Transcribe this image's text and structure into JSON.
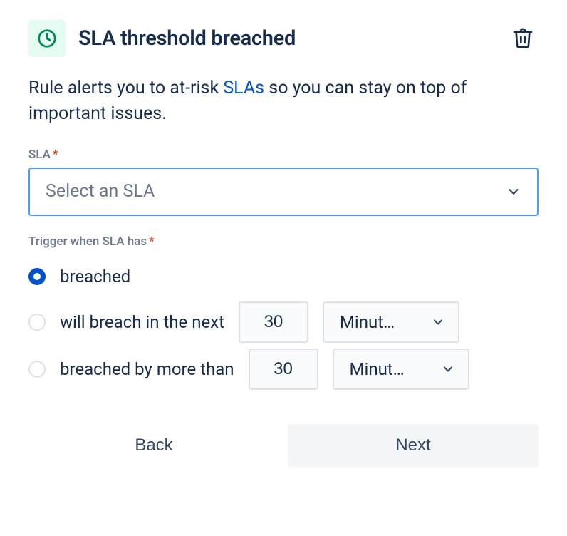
{
  "header": {
    "title": "SLA threshold breached",
    "icon_name": "clock-icon",
    "badge_bg": "#e3fcef",
    "icon_color": "#00875a"
  },
  "description": {
    "prefix": "Rule alerts you to at-risk ",
    "link_text": "SLAs",
    "suffix": " so you can stay on top of important issues."
  },
  "fields": {
    "sla": {
      "label": "SLA",
      "required_mark": "*",
      "placeholder": "Select an SLA"
    },
    "trigger": {
      "label": "Trigger when SLA has",
      "required_mark": "*",
      "options": {
        "breached": {
          "label": "breached",
          "selected": true
        },
        "will_breach": {
          "label": "will breach in the next",
          "selected": false,
          "value": "30",
          "unit": "Minut…"
        },
        "breached_by": {
          "label": "breached by more than",
          "selected": false,
          "value": "30",
          "unit": "Minut…"
        }
      }
    }
  },
  "footer": {
    "back": "Back",
    "next": "Next"
  }
}
